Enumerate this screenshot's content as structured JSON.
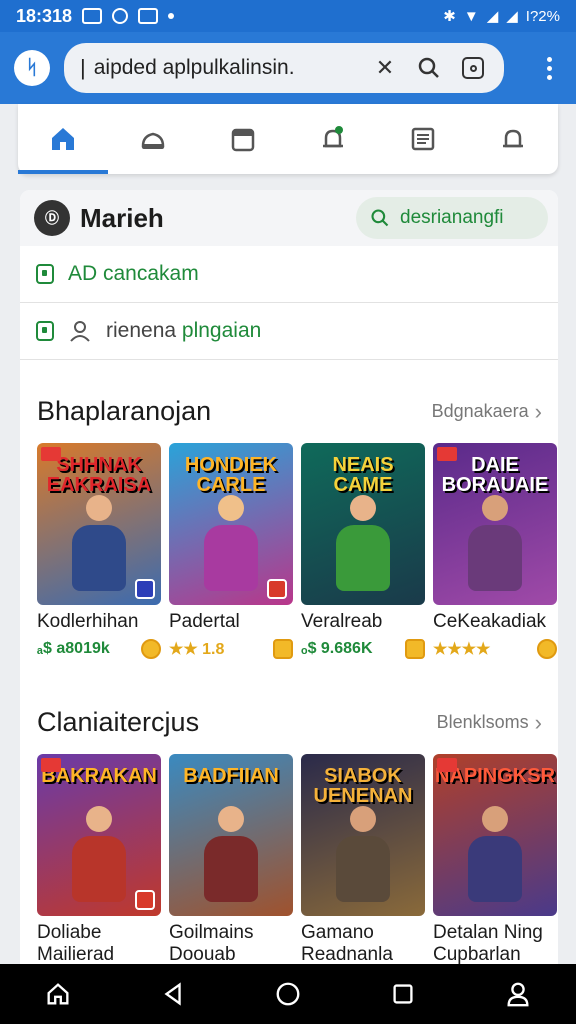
{
  "status_bar": {
    "time": "18:318",
    "battery": "I?2%"
  },
  "browser": {
    "url_text": "aipded aplpulkalinsin."
  },
  "tabs": [
    {
      "icon": "home-icon",
      "active": true
    },
    {
      "icon": "cloud-icon",
      "active": false
    },
    {
      "icon": "folder-icon",
      "active": false
    },
    {
      "icon": "bell-icon",
      "active": false
    },
    {
      "icon": "list-icon",
      "active": false
    },
    {
      "icon": "notification-icon",
      "active": false
    }
  ],
  "account": {
    "name": "Marieh",
    "avatar_text": "Ⓓ",
    "search_label": "desrianangfi"
  },
  "rows": [
    {
      "text": "AD cancakam"
    },
    {
      "text_a": "rienena",
      "text_b": "plngaian"
    }
  ],
  "sections": [
    {
      "title": "Bhaplaranojan",
      "link": "Bdgnakaera",
      "games": [
        {
          "cover_title": "SHHNAK EAKRAISA",
          "name": "Kodlerhihan",
          "meta": "ₐ$ a8019k",
          "meta_type": "price",
          "colors": [
            "#3b6bb0",
            "#d87a2b"
          ]
        },
        {
          "cover_title": "HONDIEK CARLE",
          "name": "Padertal",
          "meta": "★★ 1.8",
          "meta_type": "stars",
          "colors": [
            "#2aa3d9",
            "#b9368a"
          ]
        },
        {
          "cover_title": "NEAIS CAME",
          "name": "Veralreab",
          "meta": "ₒ$ 9.686K",
          "meta_type": "price",
          "colors": [
            "#0f6a5a",
            "#3a9a3a"
          ]
        },
        {
          "cover_title": "DAIE BORAUAIE",
          "name": "CeKeakadiak",
          "meta": "★★★★",
          "meta_type": "stars",
          "colors": [
            "#5a2a8a",
            "#a04aa8"
          ]
        }
      ]
    },
    {
      "title": "Claniaitercjus",
      "link": "Blenklsoms",
      "games": [
        {
          "cover_title": "BAKRAKAN",
          "name": "Doliabe Mailierad",
          "colors": [
            "#6a3aa8",
            "#c0392b"
          ]
        },
        {
          "cover_title": "BADFIIAN",
          "name": "Goilmains Doouab",
          "colors": [
            "#3a8ac0",
            "#a0522d"
          ]
        },
        {
          "cover_title": "SIABOK UENENAN",
          "name": "Gamano Readnanla",
          "colors": [
            "#2a2a4a",
            "#8a6a3a"
          ]
        },
        {
          "cover_title": "NAPINGKSR",
          "name": "Detalan Ning Cupbarlan",
          "colors": [
            "#b0402a",
            "#4a3a8a"
          ]
        }
      ]
    }
  ],
  "colors": {
    "primary": "#2979d6",
    "accent_green": "#1f8a3a",
    "star": "#e3a81a"
  }
}
